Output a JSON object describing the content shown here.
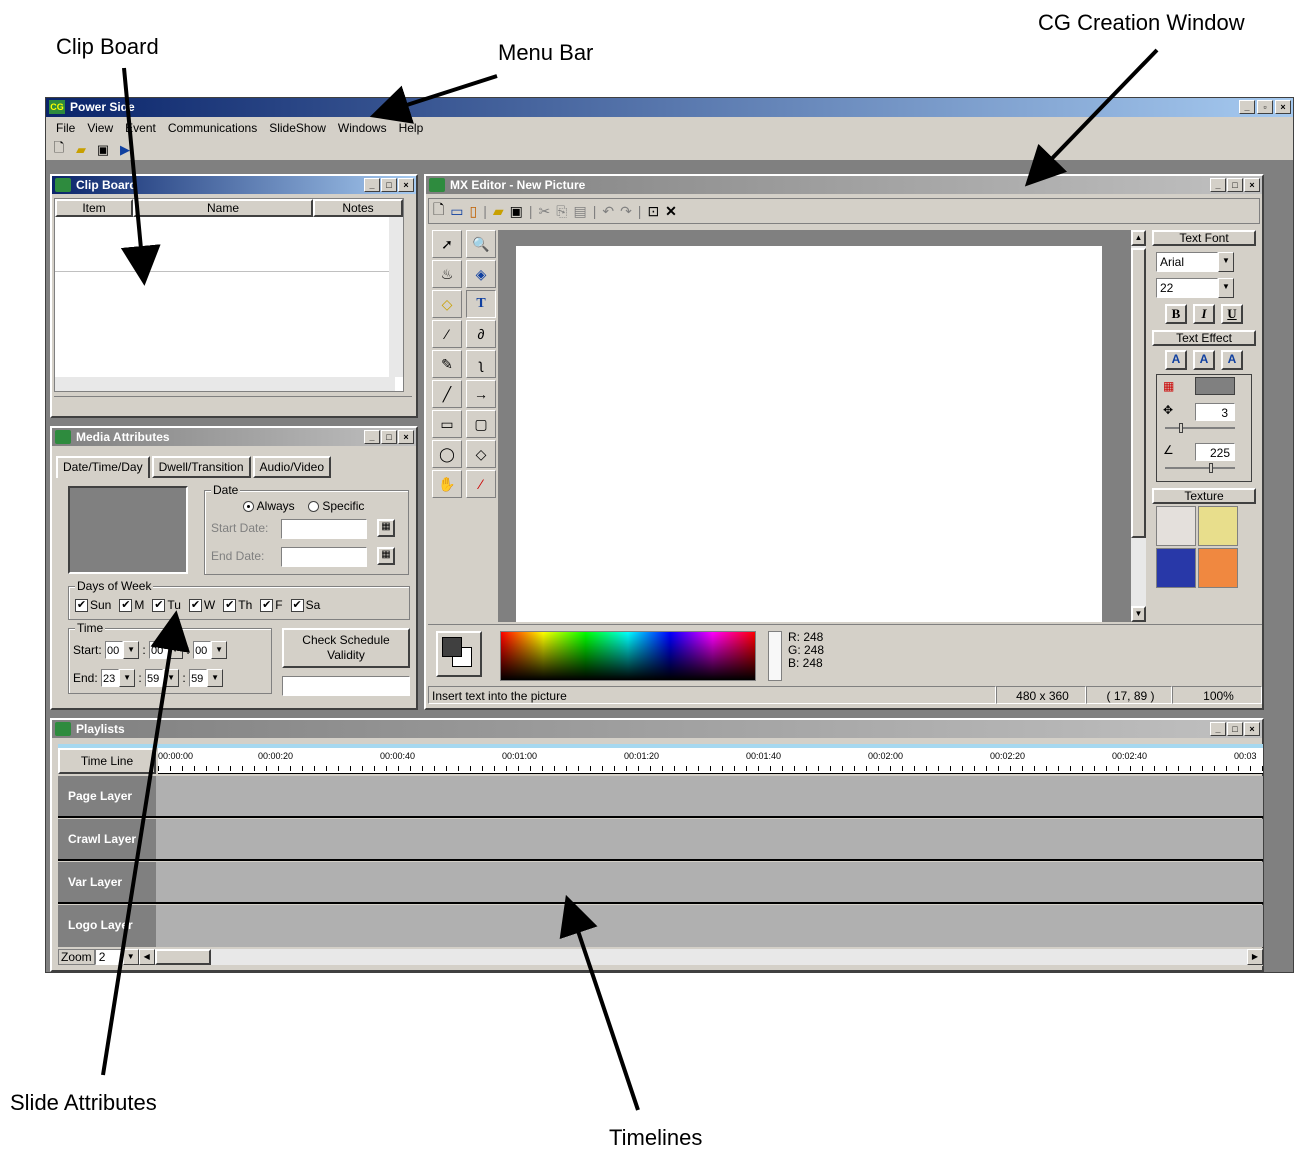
{
  "callouts": {
    "clip_board": "Clip Board",
    "menu_bar": "Menu Bar",
    "cg_creation_window": "CG Creation Window",
    "slide_attributes": "Slide Attributes",
    "timelines": "Timelines"
  },
  "app": {
    "title": "Power Side",
    "menu": [
      "File",
      "View",
      "Event",
      "Communications",
      "SlideShow",
      "Windows",
      "Help"
    ]
  },
  "clip_board": {
    "title": "Clip Board",
    "columns": [
      "Item",
      "Name",
      "Notes"
    ]
  },
  "media_attributes": {
    "title": "Media Attributes",
    "tabs": [
      "Date/Time/Day",
      "Dwell/Transition",
      "Audio/Video"
    ],
    "date_group": "Date",
    "always": "Always",
    "specific": "Specific",
    "start_date_label": "Start Date:",
    "end_date_label": "End Date:",
    "days_group": "Days of Week",
    "days": [
      "Sun",
      "M",
      "Tu",
      "W",
      "Th",
      "F",
      "Sa"
    ],
    "time_group": "Time",
    "start_label": "Start:",
    "end_label": "End:",
    "start_time": [
      "00",
      "00",
      "00"
    ],
    "end_time": [
      "23",
      "59",
      "59"
    ],
    "check_button": "Check Schedule Validity"
  },
  "mx_editor": {
    "title": "MX Editor - New Picture",
    "text_font_label": "Text Font",
    "font_name": "Arial",
    "font_size": "22",
    "bold": "B",
    "italic": "I",
    "underline": "U",
    "text_effect_label": "Text Effect",
    "effect_value_1": "3",
    "effect_value_2": "225",
    "texture_label": "Texture",
    "rgb": [
      "R: 248",
      "G: 248",
      "B: 248"
    ],
    "status": "Insert text into the picture",
    "size": "480 x 360",
    "coords": "( 17, 89 )",
    "zoom": "100%"
  },
  "playlists": {
    "title": "Playlists",
    "timeline_label": "Time Line",
    "ticks": [
      "00:00:00",
      "00:00:20",
      "00:00:40",
      "00:01:00",
      "00:01:20",
      "00:01:40",
      "00:02:00",
      "00:02:20",
      "00:02:40",
      "00:03"
    ],
    "layers": [
      "Page Layer",
      "Crawl Layer",
      "Var Layer",
      "Logo Layer"
    ],
    "zoom_label": "Zoom",
    "zoom_value": "2"
  }
}
